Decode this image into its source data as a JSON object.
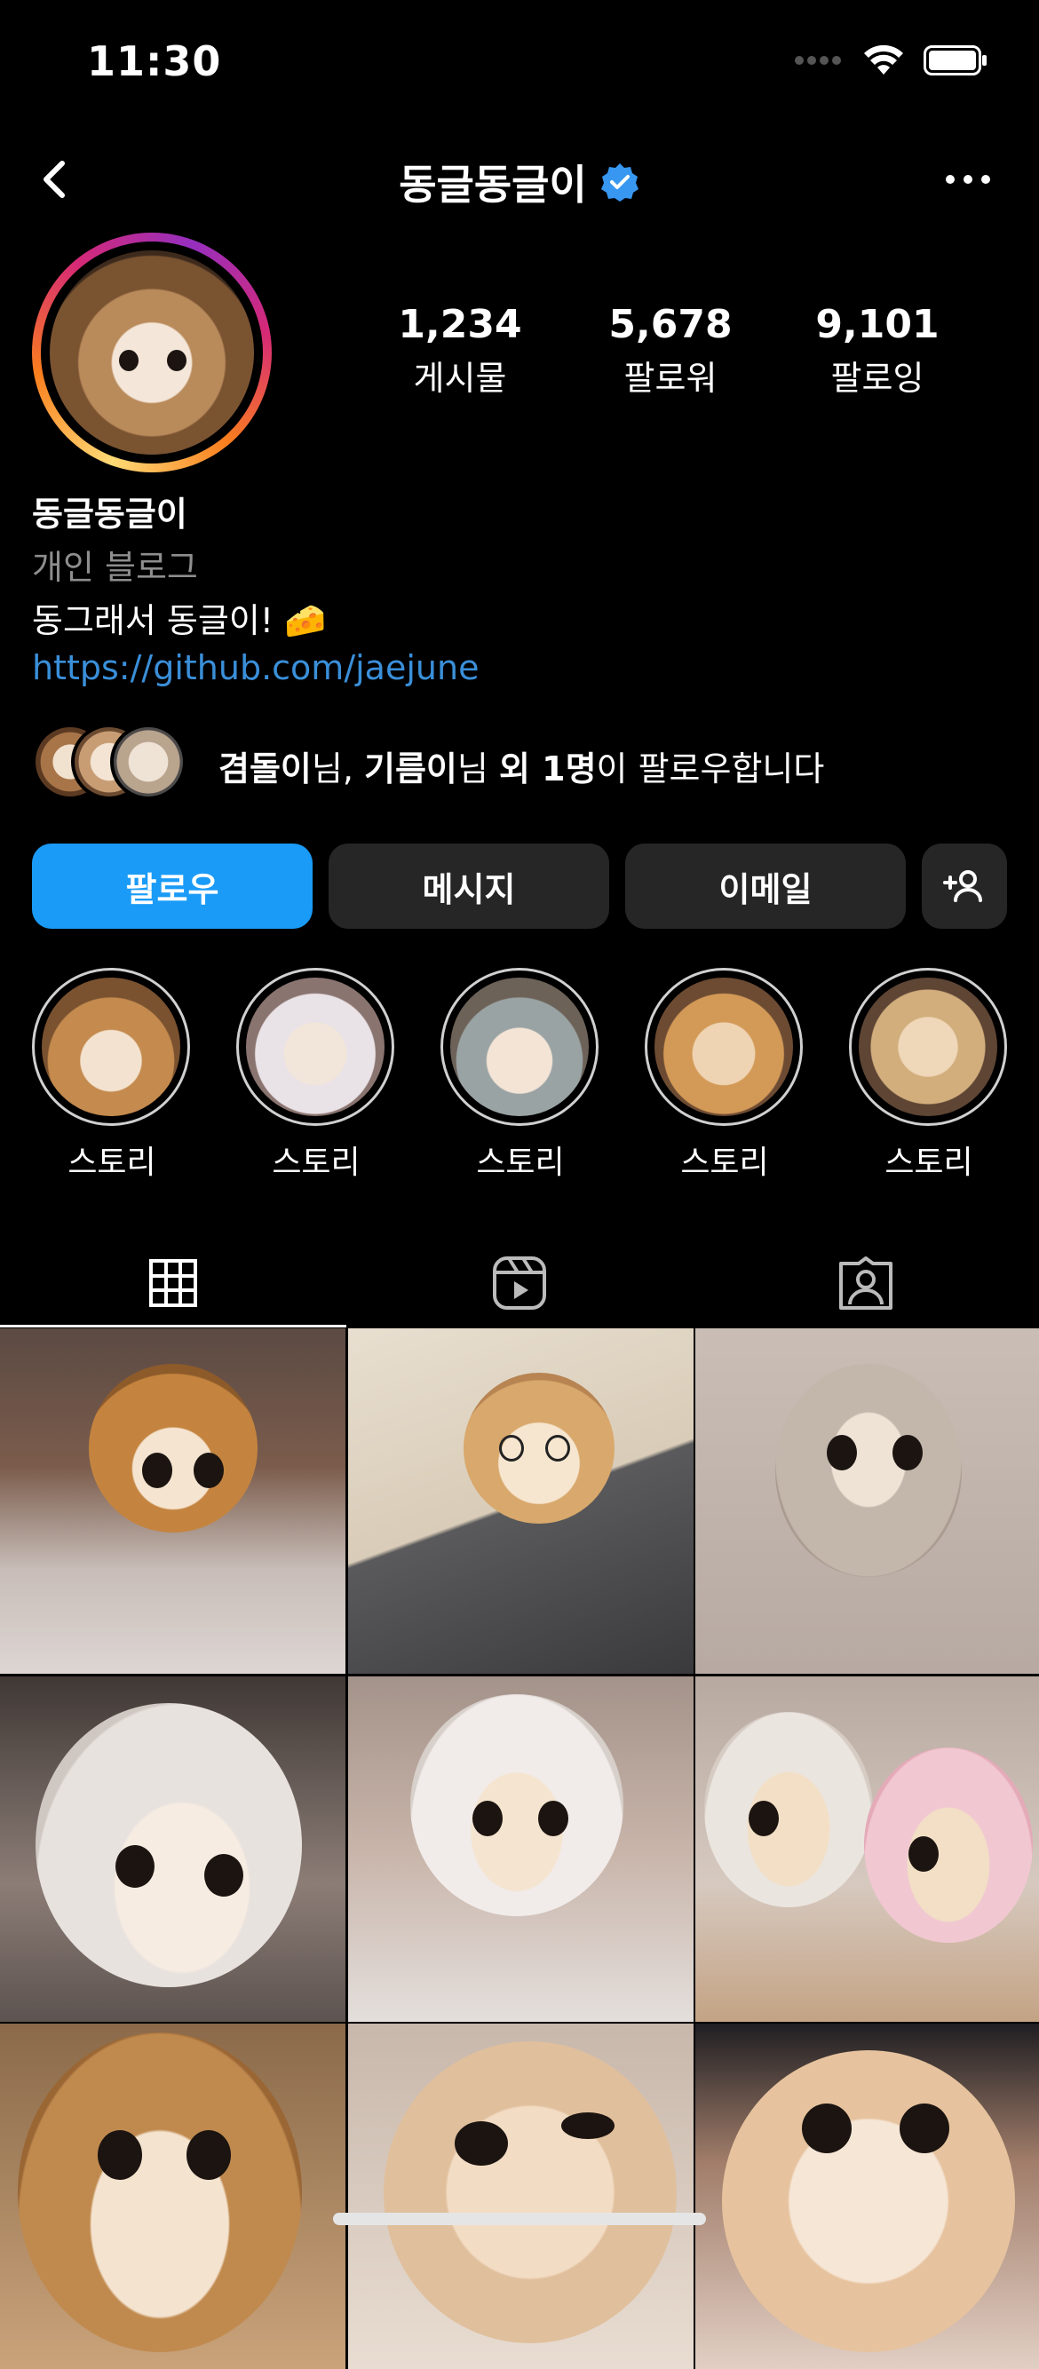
{
  "status_bar": {
    "time": "11:30"
  },
  "nav": {
    "title": "동글동글이",
    "verified": true
  },
  "stats": [
    {
      "value": "1,234",
      "label": "게시물"
    },
    {
      "value": "5,678",
      "label": "팔로워"
    },
    {
      "value": "9,101",
      "label": "팔로잉"
    }
  ],
  "bio": {
    "name": "동글동글이",
    "category": "개인 블로그",
    "text": "동그래서 동글이! 🧀",
    "link": "https://github.com/jaejune"
  },
  "followed_by": {
    "name1": "겸돌이",
    "suffix1": "님, ",
    "name2": "기름이",
    "suffix2": "님 ",
    "others": "외 1명",
    "tail": "이 팔로우합니다"
  },
  "buttons": {
    "follow": "팔로우",
    "message": "메시지",
    "email": "이메일"
  },
  "highlights": [
    {
      "label": "스토리"
    },
    {
      "label": "스토리"
    },
    {
      "label": "스토리"
    },
    {
      "label": "스토리"
    },
    {
      "label": "스토리"
    }
  ],
  "tabs": [
    "grid-icon",
    "reels-icon",
    "tagged-icon"
  ],
  "colors": {
    "accent": "#1a9bf7",
    "link": "#3a8fd9",
    "button_bg": "#262626"
  }
}
